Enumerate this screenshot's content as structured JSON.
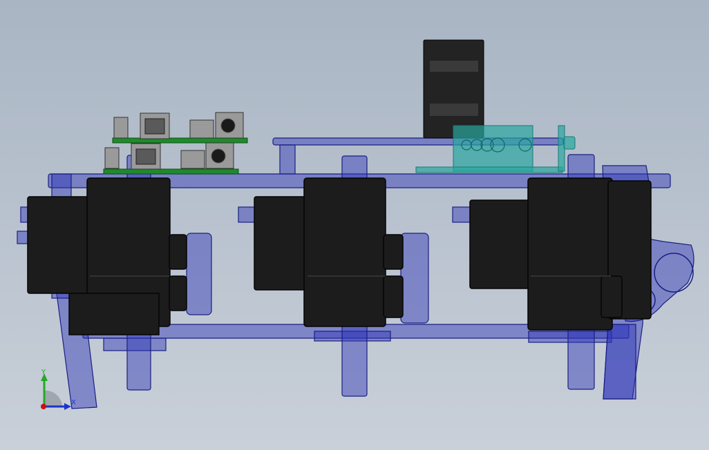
{
  "triad": {
    "y_label": "Y",
    "x_label": "X",
    "y_color": "#22aa22",
    "x_color": "#1a33cc",
    "origin_color": "#cc1111"
  },
  "colors": {
    "bg_top": "#a9b5c4",
    "bg_bottom": "#c9d0d9",
    "servo": "#1c1c1c",
    "servo_edge": "#050505",
    "frame_fill": "#2f35b8",
    "frame_edge": "#1a1e80",
    "pcb": "#1f8a2c",
    "teal_mount": "#2aa6a0",
    "battery": "#232323"
  },
  "model": {
    "servo_count": 3,
    "leg_count": 4,
    "board_count": 2
  }
}
